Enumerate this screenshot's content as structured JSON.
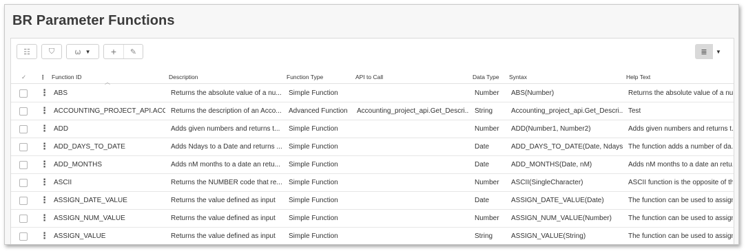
{
  "page": {
    "title": "BR Parameter Functions"
  },
  "toolbar": {
    "list_icon": "☷",
    "filter_icon": "⛉",
    "group_icon": "⍵",
    "caret": "▼",
    "add_icon": "+",
    "edit_icon": "✎",
    "view_icon": "≣"
  },
  "table": {
    "select_all_icon": "✓",
    "header_menu_icon": "⋮",
    "sort_icon": "︿",
    "columns": {
      "function_id": "Function ID",
      "description": "Description",
      "function_type": "Function Type",
      "api_to_call": "API to Call",
      "data_type": "Data Type",
      "syntax": "Syntax",
      "help_text": "Help Text"
    },
    "rows": [
      {
        "function_id": "ABS",
        "description": "Returns the absolute value of a nu...",
        "function_type": "Simple Function",
        "api_to_call": "",
        "data_type": "Number",
        "syntax": "ABS(Number)",
        "help_text": "Returns the absolute value of a nu..."
      },
      {
        "function_id": "ACCOUNTING_PROJECT_API.ACC_P...",
        "description": "Returns the description of an Acco...",
        "function_type": "Advanced Function",
        "api_to_call": "Accounting_project_api.Get_Descri...",
        "data_type": "String",
        "syntax": "Accounting_project_api.Get_Descri...",
        "help_text": "Test"
      },
      {
        "function_id": "ADD",
        "description": "Adds given numbers and returns t...",
        "function_type": "Simple Function",
        "api_to_call": "",
        "data_type": "Number",
        "syntax": "ADD(Number1, Number2)",
        "help_text": "Adds given numbers and returns t..."
      },
      {
        "function_id": "ADD_DAYS_TO_DATE",
        "description": "Adds Ndays to a Date and returns ...",
        "function_type": "Simple Function",
        "api_to_call": "",
        "data_type": "Date",
        "syntax": "ADD_DAYS_TO_DATE(Date, Ndays)",
        "help_text": "The function adds a number of da..."
      },
      {
        "function_id": "ADD_MONTHS",
        "description": "Adds nM months to a date an retu...",
        "function_type": "Simple Function",
        "api_to_call": "",
        "data_type": "Date",
        "syntax": "ADD_MONTHS(Date, nM)",
        "help_text": "Adds nM months to a date an retu..."
      },
      {
        "function_id": "ASCII",
        "description": "Returns the NUMBER code that re...",
        "function_type": "Simple Function",
        "api_to_call": "",
        "data_type": "Number",
        "syntax": "ASCII(SingleCharacter)",
        "help_text": "ASCII function is the opposite of th..."
      },
      {
        "function_id": "ASSIGN_DATE_VALUE",
        "description": "Returns the value defined as input",
        "function_type": "Simple Function",
        "api_to_call": "",
        "data_type": "Date",
        "syntax": "ASSIGN_DATE_VALUE(Date)",
        "help_text": "The function can be used to assign..."
      },
      {
        "function_id": "ASSIGN_NUM_VALUE",
        "description": "Returns the value defined as input",
        "function_type": "Simple Function",
        "api_to_call": "",
        "data_type": "Number",
        "syntax": "ASSIGN_NUM_VALUE(Number)",
        "help_text": "The function can be used to assign..."
      },
      {
        "function_id": "ASSIGN_VALUE",
        "description": "Returns the value defined as input",
        "function_type": "Simple Function",
        "api_to_call": "",
        "data_type": "String",
        "syntax": "ASSIGN_VALUE(String)",
        "help_text": "The function can be used to assign..."
      }
    ]
  }
}
